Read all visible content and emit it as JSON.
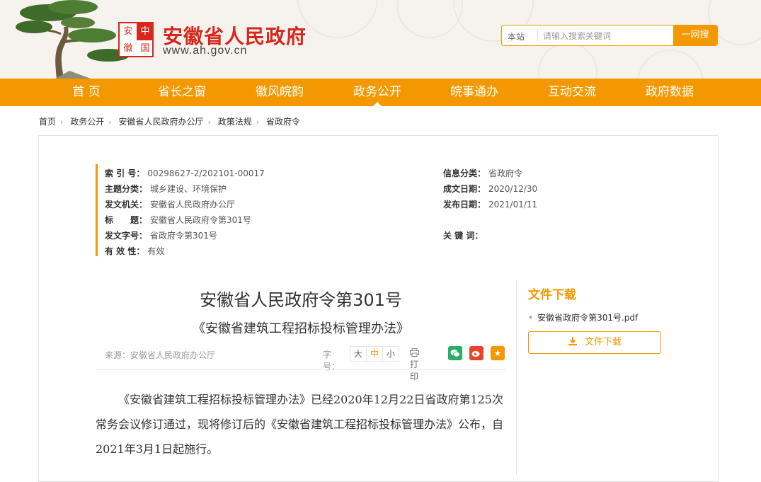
{
  "header": {
    "site_title": "安徽省人民政府",
    "site_url": "www.ah.gov.cn",
    "seal_chars": [
      "安",
      "中",
      "徽",
      "国"
    ],
    "search_scope": "本站",
    "search_placeholder": "请输入搜索关键词",
    "search_button": "一网搜"
  },
  "nav": {
    "items": [
      "首 页",
      "省长之窗",
      "徽风皖韵",
      "政务公开",
      "皖事通办",
      "互动交流",
      "政府数据"
    ],
    "active": "政务公开"
  },
  "breadcrumb": [
    "首页",
    "政务公开",
    "安徽省人民政府办公厅",
    "政策法规",
    "省政府令"
  ],
  "meta": {
    "left": [
      {
        "k": "索 引 号：",
        "v": "00298627-2/202101-00017"
      },
      {
        "k": "主题分类：",
        "v": "城乡建设、环境保护"
      },
      {
        "k": "发文机关：",
        "v": "安徽省人民政府办公厅"
      },
      {
        "k": "标　　题：",
        "v": "安徽省人民政府令第301号"
      },
      {
        "k": "发文字号：",
        "v": "省政府令第301号"
      },
      {
        "k": "有 效 性：",
        "v": "有效"
      }
    ],
    "right": [
      {
        "k": "信息分类：",
        "v": "省政府令"
      },
      {
        "k": "成文日期：",
        "v": "2020/12/30"
      },
      {
        "k": "发布日期：",
        "v": "2021/01/11"
      },
      {
        "k": "",
        "v": ""
      },
      {
        "k": "关 键 词：",
        "v": ""
      }
    ]
  },
  "article": {
    "title": "安徽省人民政府令第301号",
    "subtitle": "《安徽省建筑工程招标投标管理办法》",
    "source": "来源：安徽省人民政府办公厅",
    "font_size_label": "字号：",
    "font_sizes": [
      "大",
      "中",
      "小"
    ],
    "print_label": "打印",
    "body": "《安徽省建筑工程招标投标管理办法》已经2020年12月22日省政府第125次常务会议修订通过，现将修订后的《安徽省建筑工程招标投标管理办法》公布，自2021年3月1日起施行。"
  },
  "download": {
    "title": "文件下载",
    "file_name": "安徽省政府令第301号.pdf",
    "button": "文件下载"
  },
  "colors": {
    "accent": "#f39800",
    "brand_red": "#d7261b",
    "wechat": "#2aae67",
    "weibo": "#e6452a",
    "favorite": "#f39800"
  }
}
